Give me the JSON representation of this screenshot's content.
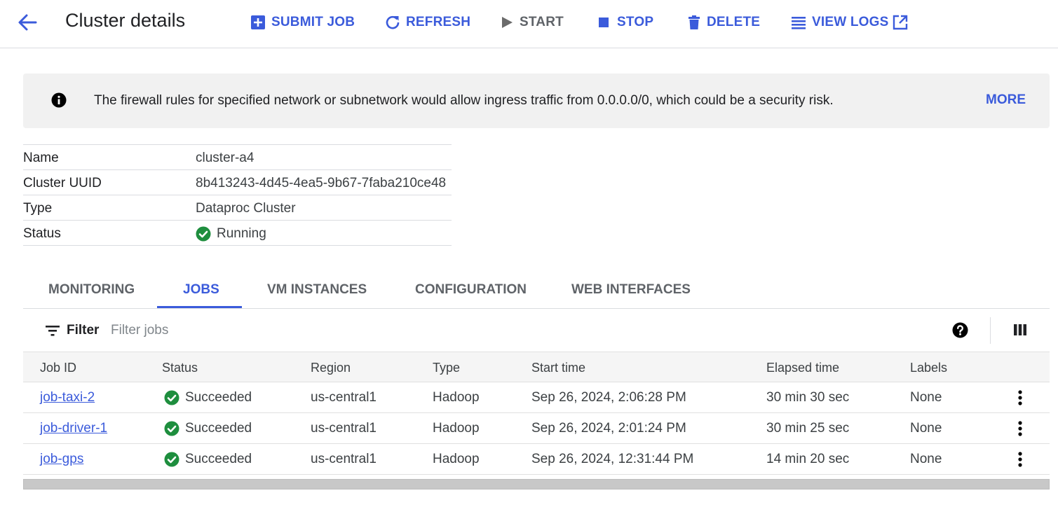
{
  "header": {
    "title": "Cluster details",
    "actions": {
      "submit_job": "SUBMIT JOB",
      "refresh": "REFRESH",
      "start": "START",
      "stop": "STOP",
      "delete": "DELETE",
      "view_logs": "VIEW LOGS"
    }
  },
  "banner": {
    "message": "The firewall rules for specified network or subnetwork would allow ingress traffic from 0.0.0.0/0, which could be a security risk.",
    "more": "MORE"
  },
  "details": [
    {
      "key": "Name",
      "value": "cluster-a4"
    },
    {
      "key": "Cluster UUID",
      "value": "8b413243-4d45-4ea5-9b67-7faba210ce48"
    },
    {
      "key": "Type",
      "value": "Dataproc Cluster"
    },
    {
      "key": "Status",
      "value": "Running"
    }
  ],
  "tabs": [
    "MONITORING",
    "JOBS",
    "VM INSTANCES",
    "CONFIGURATION",
    "WEB INTERFACES"
  ],
  "active_tab": "JOBS",
  "filter": {
    "label": "Filter",
    "placeholder": "Filter jobs"
  },
  "jobs": {
    "columns": [
      "Job ID",
      "Status",
      "Region",
      "Type",
      "Start time",
      "Elapsed time",
      "Labels"
    ],
    "rows": [
      {
        "id": "job-taxi-2",
        "status": "Succeeded",
        "region": "us-central1",
        "type": "Hadoop",
        "start": "Sep 26, 2024, 2:06:28 PM",
        "elapsed": "30 min 30 sec",
        "labels": "None"
      },
      {
        "id": "job-driver-1",
        "status": "Succeeded",
        "region": "us-central1",
        "type": "Hadoop",
        "start": "Sep 26, 2024, 2:01:24 PM",
        "elapsed": "30 min 25 sec",
        "labels": "None"
      },
      {
        "id": "job-gps",
        "status": "Succeeded",
        "region": "us-central1",
        "type": "Hadoop",
        "start": "Sep 26, 2024, 12:31:44 PM",
        "elapsed": "14 min 20 sec",
        "labels": "None"
      }
    ]
  },
  "colors": {
    "accent": "#3b5bdb",
    "success": "#1e8e3e",
    "banner_bg": "#f1f1f1"
  },
  "icons": {
    "back": "arrow-back-icon",
    "submit_job": "add-box-icon",
    "refresh": "refresh-icon",
    "start": "play-icon",
    "stop": "stop-icon",
    "delete": "trash-icon",
    "view_logs": "list-icon",
    "external": "open-in-new-icon",
    "info": "info-icon",
    "success": "check-circle-icon",
    "filter": "filter-icon",
    "help": "help-icon",
    "columns": "column-display-icon",
    "row_menu": "more-vert-icon"
  }
}
